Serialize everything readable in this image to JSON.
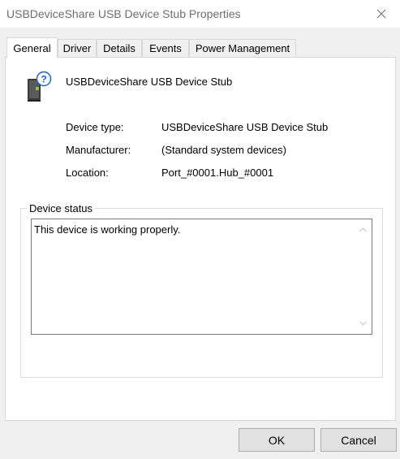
{
  "window": {
    "title": "USBDeviceShare USB Device Stub Properties",
    "close_icon": "close-icon"
  },
  "tabs": [
    {
      "label": "General",
      "active": true
    },
    {
      "label": "Driver",
      "active": false
    },
    {
      "label": "Details",
      "active": false
    },
    {
      "label": "Events",
      "active": false
    },
    {
      "label": "Power Management",
      "active": false
    }
  ],
  "general": {
    "device_icon": "unknown-usb-device-icon",
    "device_name": "USBDeviceShare USB Device Stub",
    "properties": [
      {
        "label": "Device type:",
        "value": "USBDeviceShare USB Device Stub"
      },
      {
        "label": "Manufacturer:",
        "value": "(Standard system devices)"
      },
      {
        "label": "Location:",
        "value": "Port_#0001.Hub_#0001"
      }
    ],
    "status_group_label": "Device status",
    "status_text": "This device is working properly."
  },
  "buttons": {
    "ok": "OK",
    "cancel": "Cancel"
  },
  "colors": {
    "window_bg": "#f0f0f0",
    "panel_bg": "#ffffff",
    "title_text": "#6e6e6e",
    "button_bg": "#e1e1e1"
  }
}
